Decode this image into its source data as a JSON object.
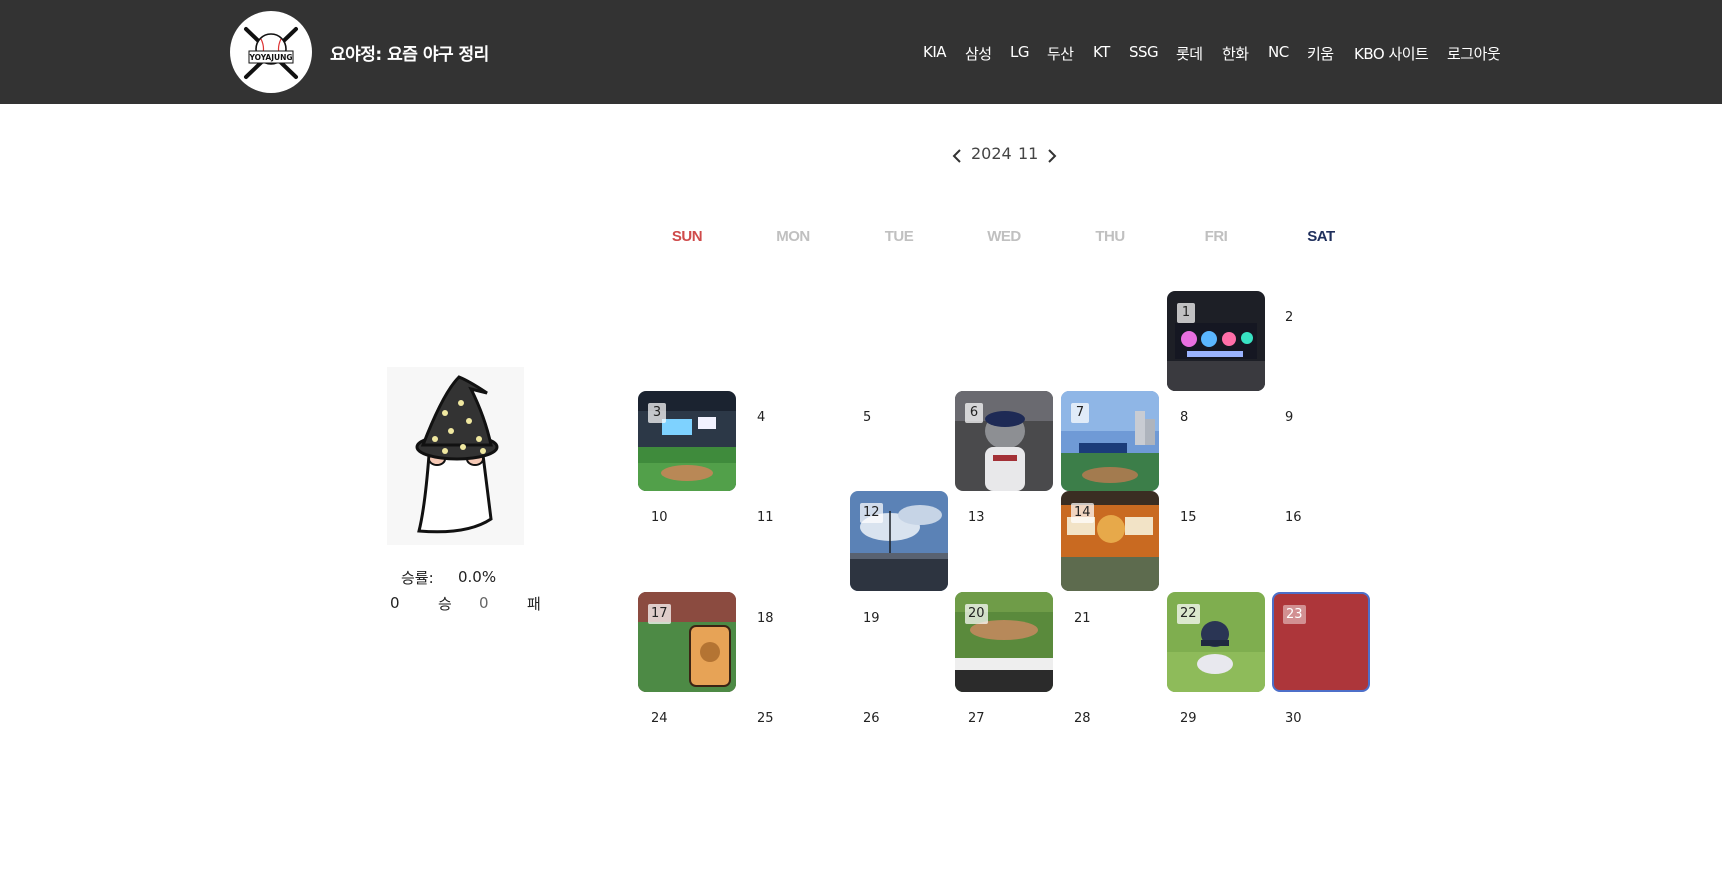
{
  "header": {
    "logo_text": "YOYAJUNG",
    "title": "요야정: 요즘 야구 정리",
    "nav": [
      "KIA",
      "삼성",
      "LG",
      "두산",
      "KT",
      "SSG",
      "롯데",
      "한화",
      "NC",
      "키움",
      "KBO 사이트",
      "로그아웃"
    ]
  },
  "calendar": {
    "year": "2024",
    "month": "11",
    "weekdays": [
      "SUN",
      "MON",
      "TUE",
      "WED",
      "THU",
      "FRI",
      "SAT"
    ],
    "days": [
      "1",
      "2",
      "3",
      "4",
      "5",
      "6",
      "7",
      "8",
      "9",
      "10",
      "11",
      "12",
      "13",
      "14",
      "15",
      "16",
      "17",
      "18",
      "19",
      "20",
      "21",
      "22",
      "23",
      "24",
      "25",
      "26",
      "27",
      "28",
      "29",
      "30"
    ],
    "selected_day": "23",
    "photo_days": [
      "1",
      "3",
      "6",
      "7",
      "12",
      "14",
      "17",
      "20",
      "22"
    ]
  },
  "profile": {
    "win_rate_label": "승률:",
    "win_rate": "0.0%",
    "wins": "0",
    "wins_label": "승",
    "losses": "0",
    "losses_label": "패"
  },
  "colors": {
    "header_bg": "#333333",
    "sunday": "#cf4a4a",
    "saturday": "#1f2f5c",
    "weekday": "#c0c0c0",
    "selected_fill": "#ad363a",
    "selected_border": "#4d6fc9"
  },
  "icons": [
    "chevron-left-icon",
    "chevron-right-icon",
    "baseball-logo-icon",
    "wizard-hat-avatar-icon"
  ]
}
